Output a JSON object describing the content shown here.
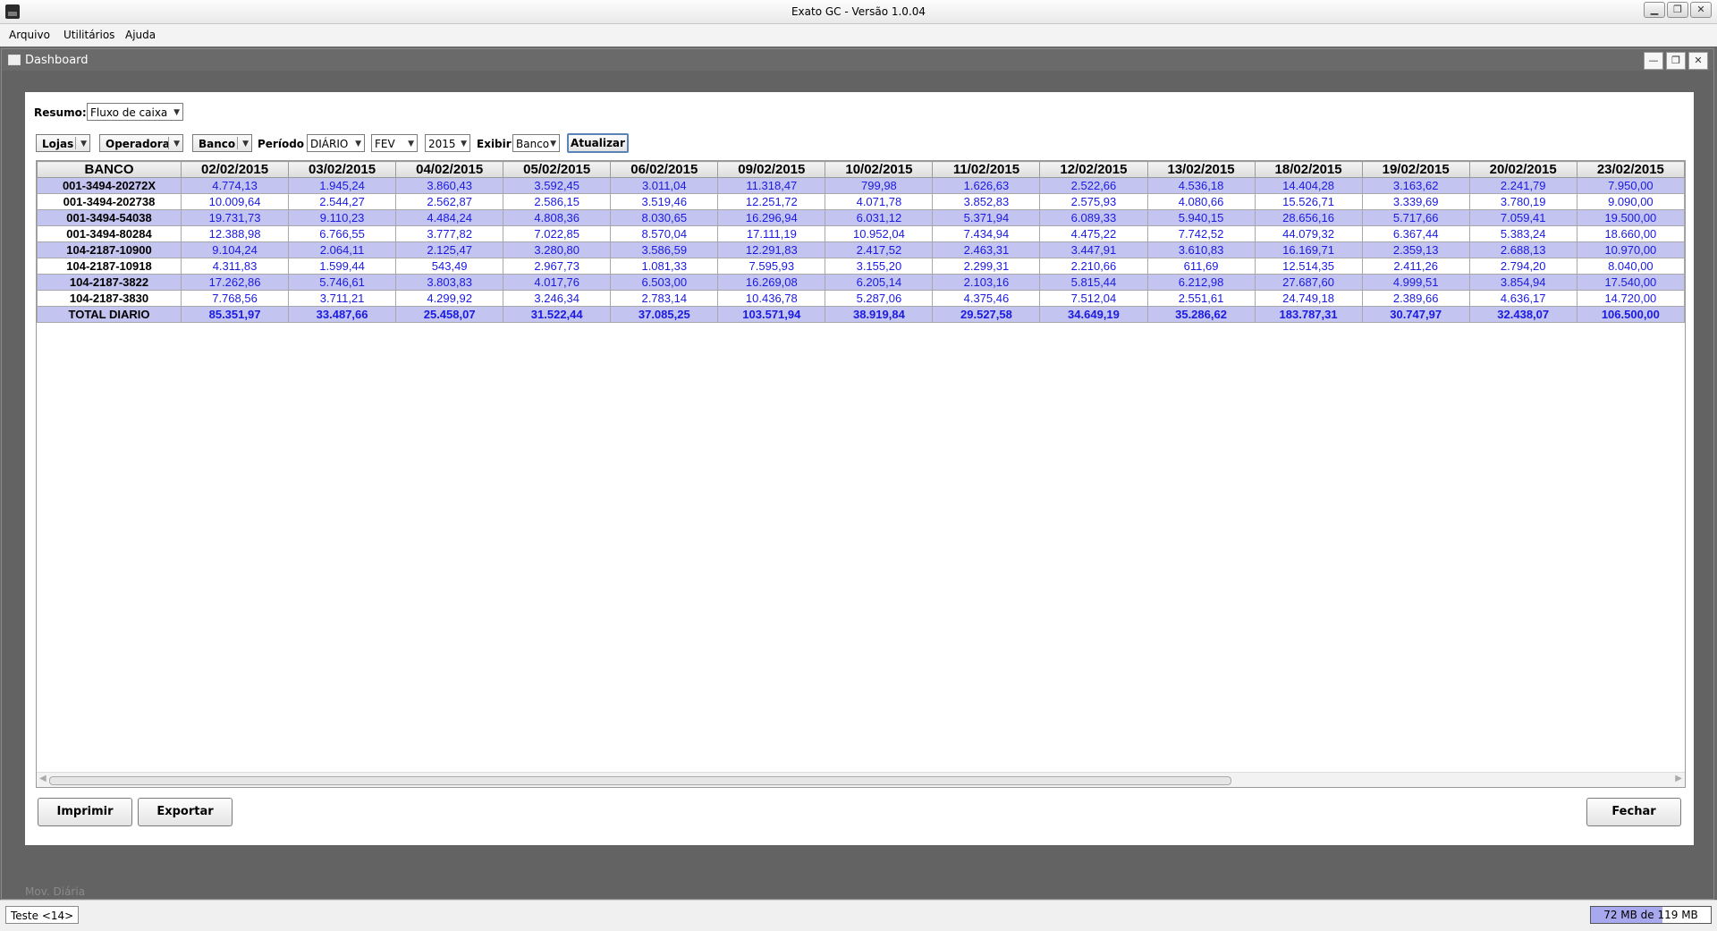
{
  "window": {
    "title": "Exato GC - Versão 1.0.04"
  },
  "menu": [
    "Arquivo",
    "Utilitários",
    "Ajuda"
  ],
  "frame": {
    "title": "Dashboard"
  },
  "resumo": {
    "label": "Resumo:",
    "value": "Fluxo de caixa"
  },
  "filters": {
    "lojas": "Lojas",
    "operadora": "Operadora",
    "banco": "Banco",
    "periodo_label": "Período",
    "periodo_value": "DIÁRIO",
    "mes_value": "FEV",
    "ano_value": "2015",
    "exibir_label": "Exibir",
    "exibir_value": "Banco",
    "atualizar": "Atualizar"
  },
  "table": {
    "columns": [
      "BANCO",
      "02/02/2015",
      "03/02/2015",
      "04/02/2015",
      "05/02/2015",
      "06/02/2015",
      "09/02/2015",
      "10/02/2015",
      "11/02/2015",
      "12/02/2015",
      "13/02/2015",
      "18/02/2015",
      "19/02/2015",
      "20/02/2015",
      "23/02/2015"
    ],
    "rows": [
      [
        "001-3494-20272X",
        "4.774,13",
        "1.945,24",
        "3.860,43",
        "3.592,45",
        "3.011,04",
        "11.318,47",
        "799,98",
        "1.626,63",
        "2.522,66",
        "4.536,18",
        "14.404,28",
        "3.163,62",
        "2.241,79",
        "7.950,00"
      ],
      [
        "001-3494-202738",
        "10.009,64",
        "2.544,27",
        "2.562,87",
        "2.586,15",
        "3.519,46",
        "12.251,72",
        "4.071,78",
        "3.852,83",
        "2.575,93",
        "4.080,66",
        "15.526,71",
        "3.339,69",
        "3.780,19",
        "9.090,00"
      ],
      [
        "001-3494-54038",
        "19.731,73",
        "9.110,23",
        "4.484,24",
        "4.808,36",
        "8.030,65",
        "16.296,94",
        "6.031,12",
        "5.371,94",
        "6.089,33",
        "5.940,15",
        "28.656,16",
        "5.717,66",
        "7.059,41",
        "19.500,00"
      ],
      [
        "001-3494-80284",
        "12.388,98",
        "6.766,55",
        "3.777,82",
        "7.022,85",
        "8.570,04",
        "17.111,19",
        "10.952,04",
        "7.434,94",
        "4.475,22",
        "7.742,52",
        "44.079,32",
        "6.367,44",
        "5.383,24",
        "18.660,00"
      ],
      [
        "104-2187-10900",
        "9.104,24",
        "2.064,11",
        "2.125,47",
        "3.280,80",
        "3.586,59",
        "12.291,83",
        "2.417,52",
        "2.463,31",
        "3.447,91",
        "3.610,83",
        "16.169,71",
        "2.359,13",
        "2.688,13",
        "10.970,00"
      ],
      [
        "104-2187-10918",
        "4.311,83",
        "1.599,44",
        "543,49",
        "2.967,73",
        "1.081,33",
        "7.595,93",
        "3.155,20",
        "2.299,31",
        "2.210,66",
        "611,69",
        "12.514,35",
        "2.411,26",
        "2.794,20",
        "8.040,00"
      ],
      [
        "104-2187-3822",
        "17.262,86",
        "5.746,61",
        "3.803,83",
        "4.017,76",
        "6.503,00",
        "16.269,08",
        "6.205,14",
        "2.103,16",
        "5.815,44",
        "6.212,98",
        "27.687,60",
        "4.999,51",
        "3.854,94",
        "17.540,00"
      ],
      [
        "104-2187-3830",
        "7.768,56",
        "3.711,21",
        "4.299,92",
        "3.246,34",
        "2.783,14",
        "10.436,78",
        "5.287,06",
        "4.375,46",
        "7.512,04",
        "2.551,61",
        "24.749,18",
        "2.389,66",
        "4.636,17",
        "14.720,00"
      ]
    ],
    "total": [
      "TOTAL DIARIO",
      "85.351,97",
      "33.487,66",
      "25.458,07",
      "31.522,44",
      "37.085,25",
      "103.571,94",
      "38.919,84",
      "29.527,58",
      "34.649,19",
      "35.286,62",
      "183.787,31",
      "30.747,97",
      "32.438,07",
      "106.500,00"
    ]
  },
  "buttons": {
    "imprimir": "Imprimir",
    "exportar": "Exportar",
    "fechar": "Fechar"
  },
  "minimized_frame": "Mov. Diária",
  "status": {
    "left": "Teste <14>",
    "memory": "72 MB de 119 MB",
    "memory_fraction": 0.6
  }
}
